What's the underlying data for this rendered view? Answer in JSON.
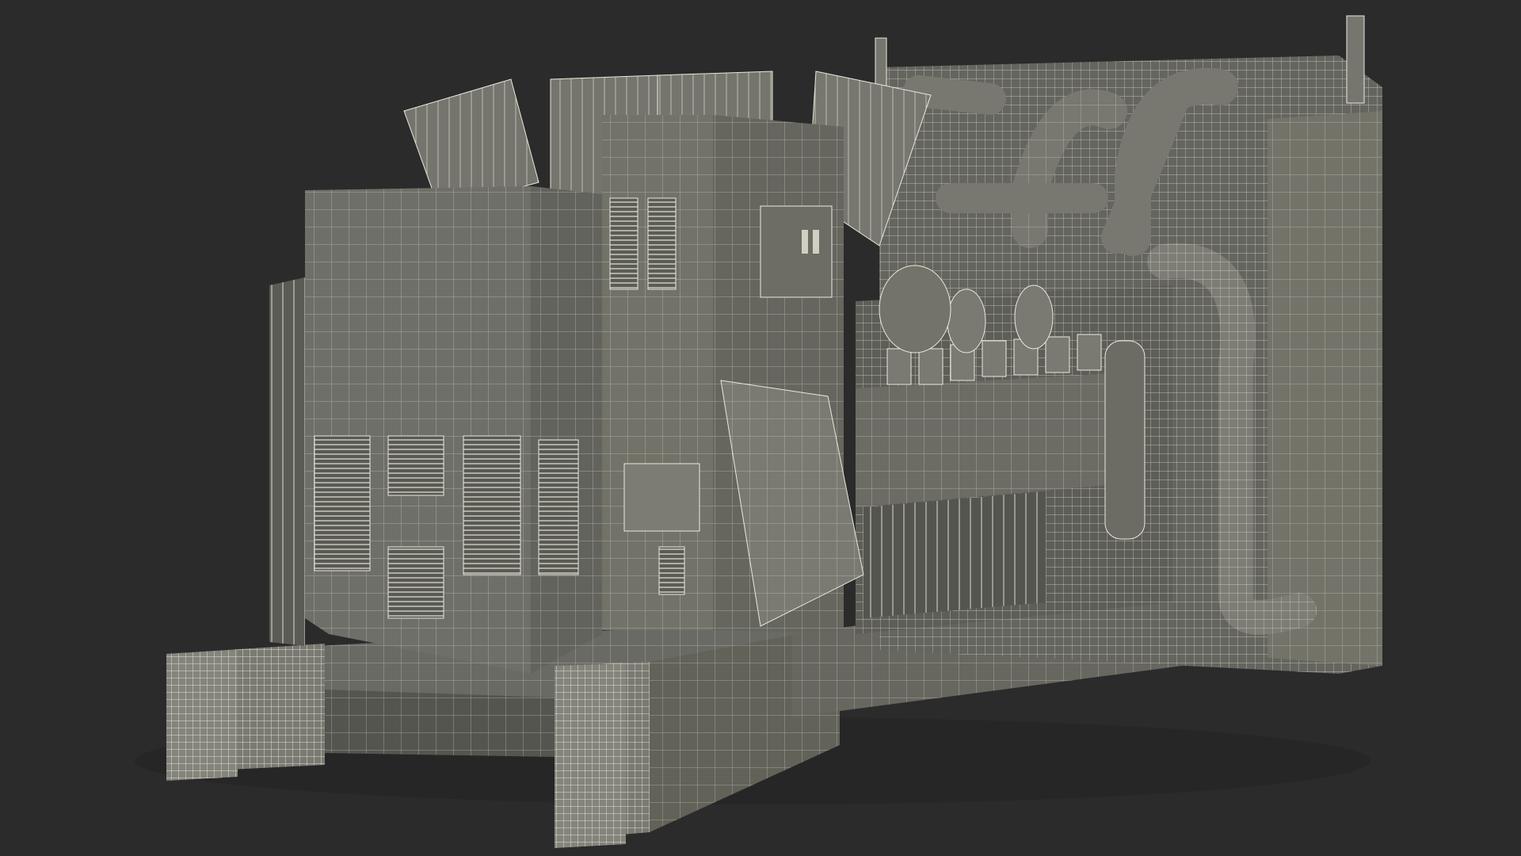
{
  "scene": {
    "background_color": "#2b2b2b",
    "subject": "wireframe-render",
    "colors": {
      "body_fill": "#6f6f69",
      "body_fill_dark": "#5b5b56",
      "body_fill_light": "#7d7d76",
      "wire": "#e9e9dd",
      "wire_soft": "#c9c9bd",
      "shadow": "#232323"
    }
  }
}
